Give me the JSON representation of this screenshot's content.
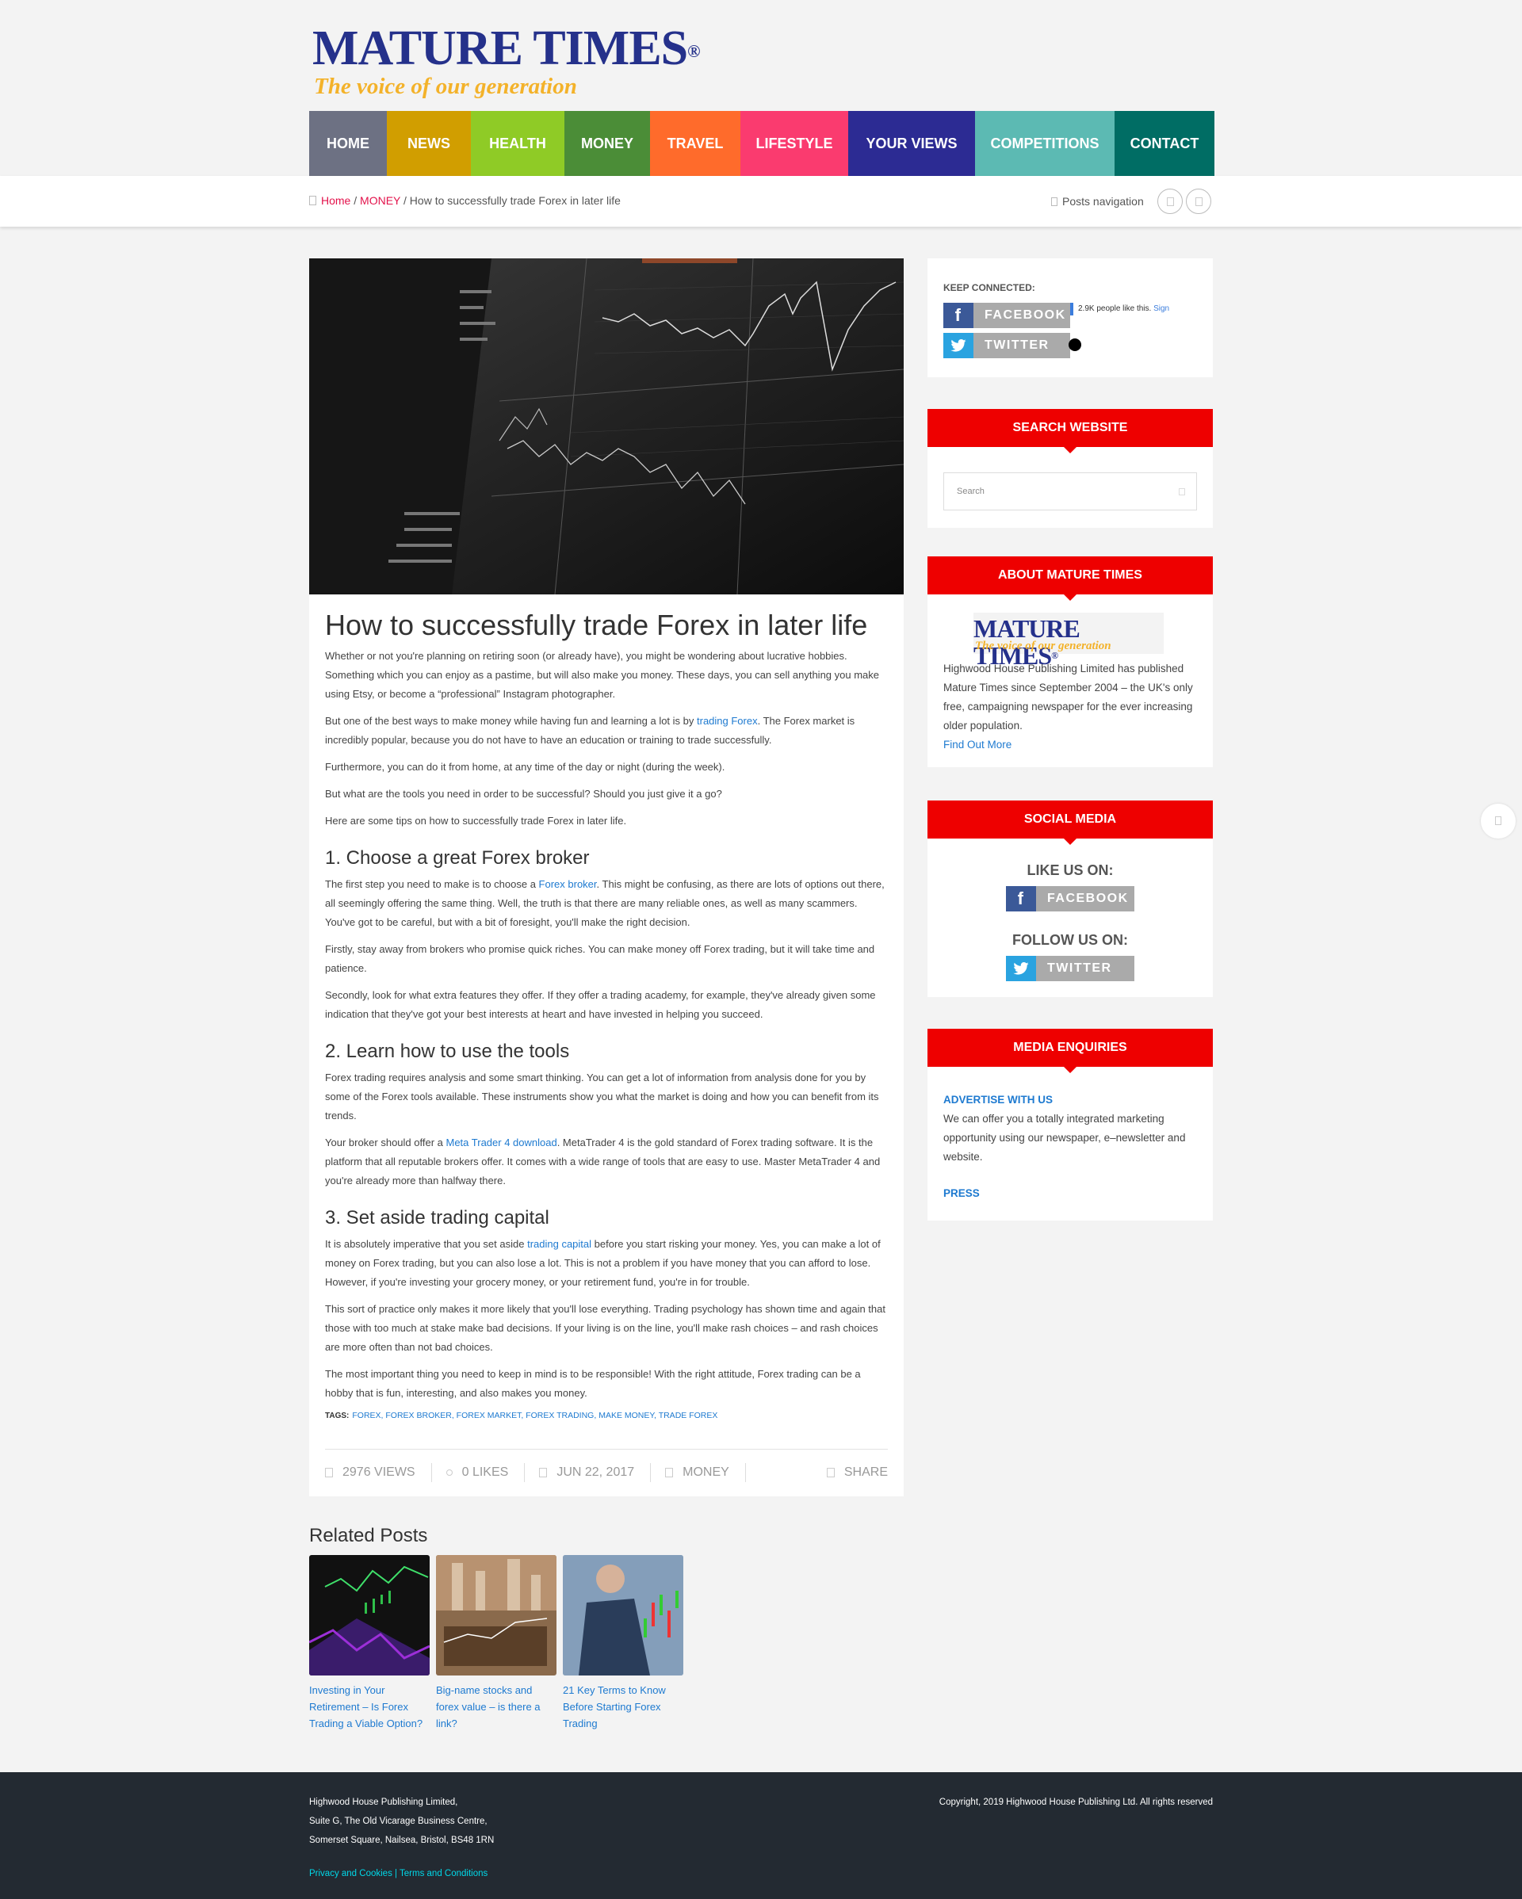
{
  "logo": {
    "title": "MATURE TIMES",
    "reg": "®",
    "tagline": "The voice of our generation"
  },
  "nav": [
    {
      "label": "HOME",
      "color": "#6d7183"
    },
    {
      "label": "NEWS",
      "color": "#d19e00"
    },
    {
      "label": "HEALTH",
      "color": "#8fcb26"
    },
    {
      "label": "MONEY",
      "color": "#4b8d37"
    },
    {
      "label": "TRAVEL",
      "color": "#ff6b2b"
    },
    {
      "label": "LIFESTYLE",
      "color": "#fa3b6f"
    },
    {
      "label": "YOUR VIEWS",
      "color": "#2c2b93"
    },
    {
      "label": "COMPETITIONS",
      "color": "#5cbab3"
    },
    {
      "label": "CONTACT",
      "color": "#006d64"
    }
  ],
  "breadcrumb": {
    "home": "Home",
    "sep": "/",
    "category": "MONEY",
    "current": "How to successfully trade Forex in later life"
  },
  "posts_nav": {
    "label": "Posts navigation"
  },
  "article": {
    "title": "How to successfully trade Forex in later life",
    "p1": "Whether or not you're planning on retiring soon (or already have), you might be wondering about lucrative hobbies. Something which you can enjoy as a pastime, but will also make you money. These days, you can sell anything you make using Etsy, or become a “professional” Instagram photographer.",
    "p2a": "But one of the best ways to make money while having fun and learning a lot is by ",
    "p2link": "trading Forex",
    "p2b": ". The Forex market is incredibly popular, because you do not have to have an education or training to trade successfully.",
    "p3": "Furthermore, you can do it from home, at any time of the day or night (during the week).",
    "p4": "But what are the tools you need in order to be successful? Should you just give it a go?",
    "p5": "Here are some tips on how to successfully trade Forex in later life.",
    "h1": "1. Choose a great Forex broker",
    "p6a": "The first step you need to make is to choose a ",
    "p6link": "Forex broker",
    "p6b": ". This might be confusing, as there are lots of options out there, all seemingly offering the same thing. Well, the truth is that there are many reliable ones, as well as many scammers. You've got to be careful, but with a bit of foresight, you'll make the right decision.",
    "p7": "Firstly, stay away from brokers who promise quick riches. You can make money off Forex trading, but it will take time and patience.",
    "p8": "Secondly, look for what extra features they offer. If they offer a trading academy, for example, they've already given some indication that they've got your best interests at heart and have invested in helping you succeed.",
    "h2": "2. Learn how to use the tools",
    "p9": "Forex trading requires analysis and some smart thinking. You can get a lot of information from analysis done for you by some of the Forex tools available. These instruments show you what the market is doing and how you can benefit from its trends.",
    "p10a": "Your broker should offer a ",
    "p10link": "Meta Trader 4 download",
    "p10b": ". MetaTrader 4 is the gold standard of Forex trading software. It is the platform that all reputable brokers offer. It comes with a wide range of tools that are easy to use. Master MetaTrader 4 and you're already more than halfway there.",
    "h3": "3. Set aside trading capital",
    "p11a": "It is absolutely imperative that you set aside ",
    "p11link": "trading capital",
    "p11b": " before you start risking your money. Yes, you can make a lot of money on Forex trading, but you can also lose a lot. This is not a problem if you have money that you can afford to lose. However, if you're investing your grocery money, or your retirement fund, you're in for trouble.",
    "p12": "This sort of practice only makes it more likely that you'll lose everything. Trading psychology has shown time and again that those with too much at stake make bad decisions. If your living is on the line, you'll make rash choices – and rash choices are more often than not bad choices.",
    "p13": "The most important thing you need to keep in mind is to be responsible! With the right attitude, Forex trading can be a hobby that is fun, interesting, and also makes you money.",
    "tags_label": "TAGS:",
    "tags": [
      "FOREX",
      "FOREX BROKER",
      "FOREX MARKET",
      "FOREX TRADING",
      "MAKE MONEY",
      "TRADE FOREX"
    ],
    "meta": {
      "views": "2976 VIEWS",
      "likes": "0 LIKES",
      "date": "JUN 22, 2017",
      "category": "MONEY",
      "share": "SHARE"
    }
  },
  "related": {
    "title": "Related Posts",
    "items": [
      {
        "caption": "Investing in Your Retirement – Is Forex Trading a Viable Option?"
      },
      {
        "caption": "Big-name stocks and forex value – is there a link?"
      },
      {
        "caption": "21 Key Terms to Know Before Starting Forex Trading"
      }
    ]
  },
  "sidebar": {
    "keep_connected": "KEEP CONNECTED:",
    "facebook": "FACEBOOK",
    "twitter": "TWITTER",
    "fb_like_count": "2.9K people like this.",
    "fb_signup": "Sign",
    "search_title": "SEARCH WEBSITE",
    "search_placeholder": "Search",
    "about_title": "ABOUT MATURE TIMES",
    "about_text": "Highwood House Publishing Limited has published Mature Times since September 2004 – the UK's only free, campaigning newspaper for the ever increasing older population.",
    "about_link": "Find Out More",
    "social_title": "SOCIAL MEDIA",
    "like_us": "LIKE US ON:",
    "follow_us": "FOLLOW US ON:",
    "media_title": "MEDIA ENQUIRIES",
    "advertise": "ADVERTISE WITH US",
    "media_text": "We can offer you a totally integrated marketing opportunity using our newspaper, e–newsletter and website.",
    "press": "PRESS"
  },
  "footer": {
    "addr1": "Highwood House Publishing Limited,",
    "addr2": "Suite G, The Old Vicarage Business Centre,",
    "addr3": "Somerset Square, Nailsea, Bristol, BS48 1RN",
    "privacy": "Privacy and Cookies",
    "sep": "|",
    "terms": "Terms and Conditions",
    "copyright": "Copyright, 2019 Highwood House Publishing Ltd. All rights reserved"
  }
}
